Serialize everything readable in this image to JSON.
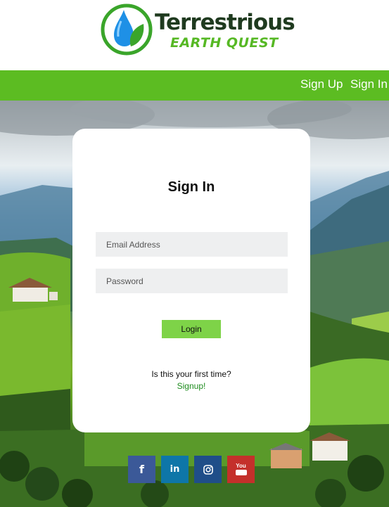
{
  "brand": {
    "name": "Terrestrious",
    "tagline": "EARTH QUEST",
    "logo_icon": "water-drop-leaf-icon",
    "primary_color": "#5cbc22",
    "accent_color": "#2196f3"
  },
  "nav": {
    "signup_label": "Sign Up",
    "signin_label": "Sign In"
  },
  "signin_card": {
    "title": "Sign In",
    "email_placeholder": "Email Address",
    "password_placeholder": "Password",
    "login_label": "Login",
    "first_time_text": "Is this your first time?",
    "signup_link": "Signup!"
  },
  "social": [
    {
      "name": "facebook-icon",
      "glyph": "f",
      "color": "#3b5998"
    },
    {
      "name": "linkedin-icon",
      "glyph": "in",
      "color": "#0e76a8"
    },
    {
      "name": "instagram-icon",
      "glyph": "",
      "color": "#1f4e89"
    },
    {
      "name": "youtube-icon",
      "glyph": "You",
      "color": "#c4302b"
    }
  ]
}
